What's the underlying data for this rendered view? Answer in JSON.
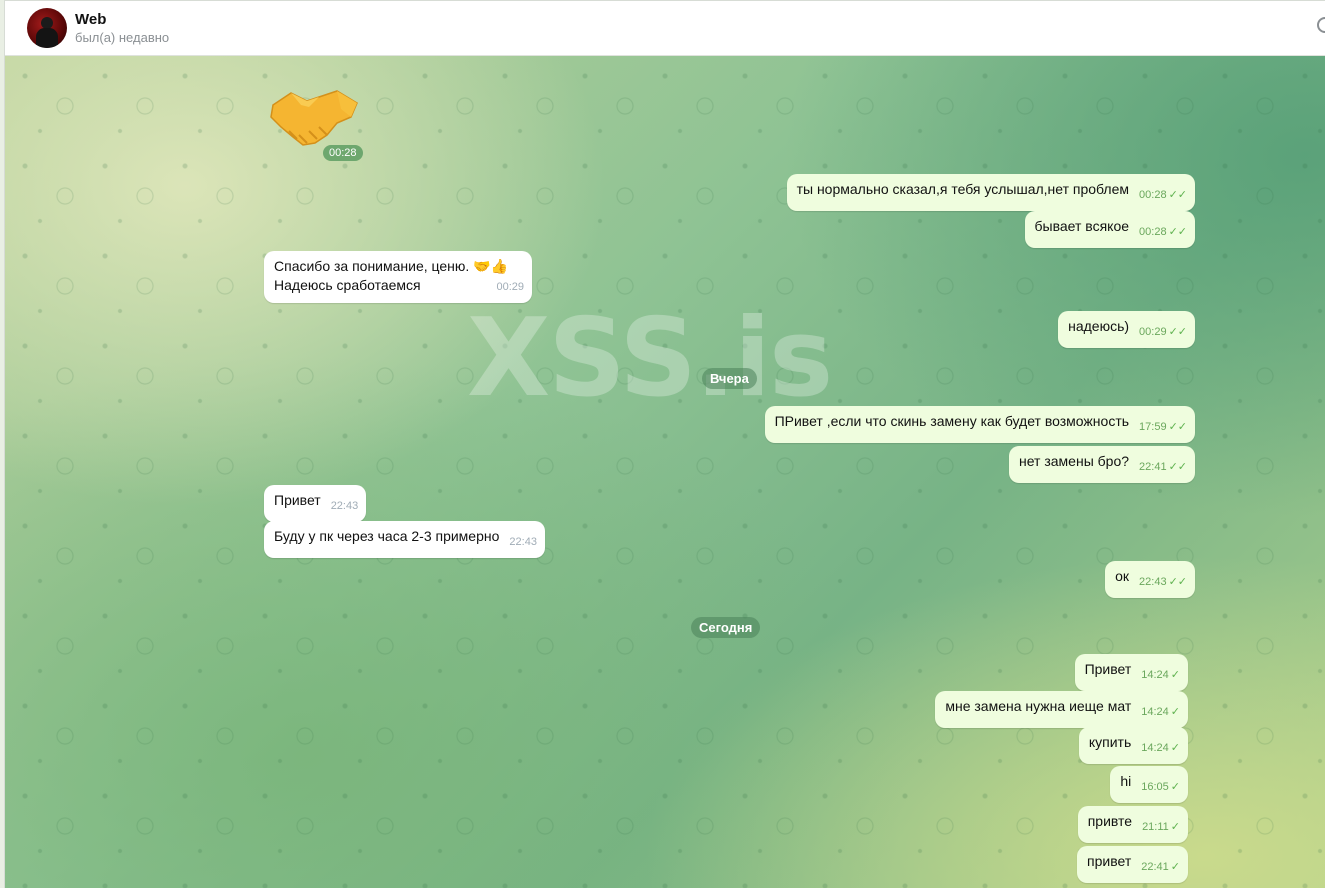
{
  "header": {
    "title": "Web",
    "status": "был(а) недавно"
  },
  "watermark": "XSS.is",
  "dates": {
    "yesterday": "Вчера",
    "today": "Сегодня"
  },
  "sticker": {
    "icon": "handshake-icon",
    "time": "00:28"
  },
  "messages": [
    {
      "dir": "out",
      "text": "ты нормально сказал,я тебя услышал,нет проблем",
      "time": "00:28",
      "status": "read"
    },
    {
      "dir": "out",
      "text": "бывает всякое",
      "time": "00:28",
      "status": "read"
    },
    {
      "dir": "in",
      "text": "Спасибо за понимание, ценю. 🤝👍",
      "text2": "Надеюсь сработаемся",
      "time": "00:29"
    },
    {
      "dir": "out",
      "text": "надеюсь)",
      "time": "00:29",
      "status": "read"
    },
    {
      "dir": "out",
      "text": "ПРивет ,если что скинь замену как будет возможность",
      "time": "17:59",
      "status": "read"
    },
    {
      "dir": "out",
      "text": "нет замены бро?",
      "time": "22:41",
      "status": "read"
    },
    {
      "dir": "in",
      "text": "Привет",
      "time": "22:43"
    },
    {
      "dir": "in",
      "text": "Буду у пк через часа 2-3 примерно",
      "time": "22:43"
    },
    {
      "dir": "out",
      "text": "ок",
      "time": "22:43",
      "status": "read"
    },
    {
      "dir": "out",
      "text": "Привет",
      "time": "14:24",
      "status": "sent"
    },
    {
      "dir": "out",
      "text": "мне замена нужна иеще мат",
      "time": "14:24",
      "status": "sent"
    },
    {
      "dir": "out",
      "text": "купить",
      "time": "14:24",
      "status": "sent"
    },
    {
      "dir": "out",
      "text": "hi",
      "time": "16:05",
      "status": "sent"
    },
    {
      "dir": "out",
      "text": "привте",
      "time": "21:11",
      "status": "sent"
    },
    {
      "dir": "out",
      "text": "привет",
      "time": "22:41",
      "status": "sent"
    }
  ],
  "colors": {
    "incoming_bubble": "#ffffff",
    "outgoing_bubble": "#effdde",
    "check_color": "#5fb24f"
  }
}
